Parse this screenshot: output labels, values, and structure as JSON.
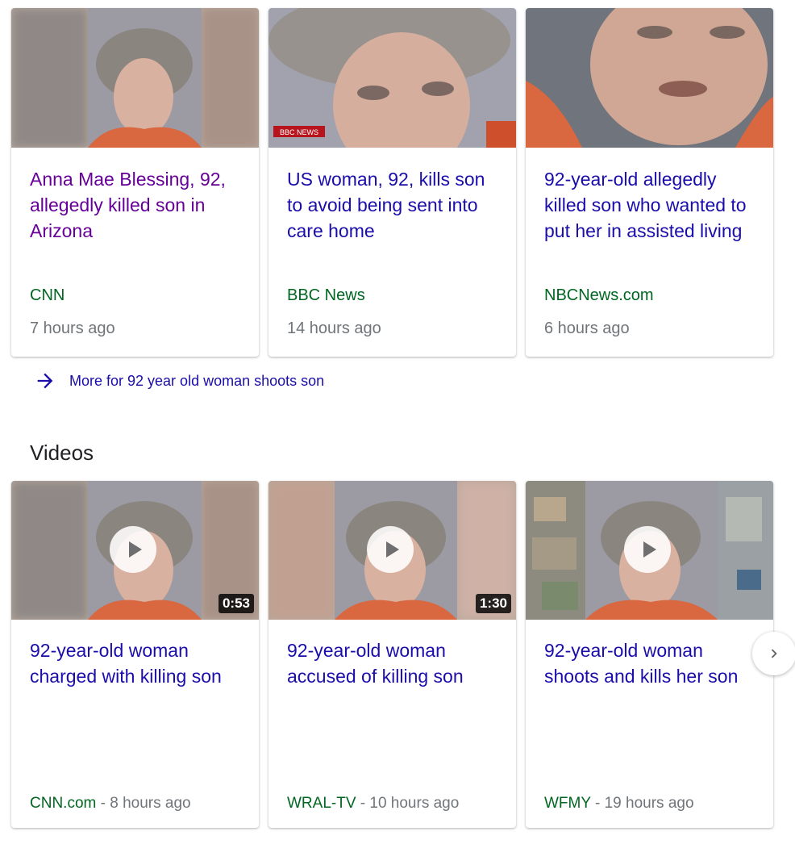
{
  "top_stories": [
    {
      "headline": "Anna Mae Blessing, 92, allegedly killed son in Arizona",
      "source": "CNN",
      "age": "7 hours ago",
      "visited": true
    },
    {
      "headline": "US woman, 92, kills son to avoid being sent into care home",
      "source": "BBC News",
      "age": "14 hours ago",
      "visited": false,
      "thumb_watermark": "BBC NEWS"
    },
    {
      "headline": "92-year-old allegedly killed son who wanted to put her in assisted living",
      "source": "NBCNews.com",
      "age": "6 hours ago",
      "visited": false
    }
  ],
  "more_link": {
    "label": "More for 92 year old woman shoots son",
    "icon": "arrow-right-icon"
  },
  "videos": {
    "title": "Videos",
    "items": [
      {
        "headline": "92-year-old woman charged with killing son",
        "duration": "0:53",
        "source": "CNN.com",
        "age": "8 hours ago",
        "separator": " - "
      },
      {
        "headline": "92-year-old woman accused of killing son",
        "duration": "1:30",
        "source": "WRAL-TV",
        "age": "10 hours ago",
        "separator": " - "
      },
      {
        "headline": "92-year-old woman shoots and kills her son",
        "duration": "",
        "source": "WFMY",
        "age": "19 hours ago",
        "separator": " - "
      }
    ],
    "next_icon": "chevron-right-icon"
  },
  "colors": {
    "link": "#1a0dab",
    "visited": "#660099",
    "source": "#006621",
    "meta": "#70757a"
  }
}
